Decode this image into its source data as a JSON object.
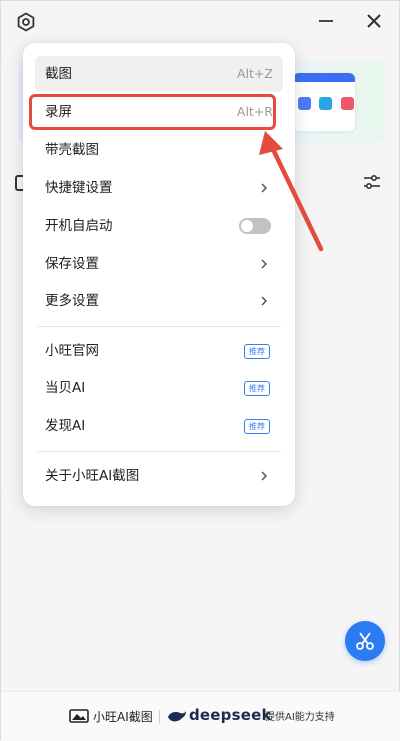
{
  "menu": {
    "items": [
      {
        "label": "截图",
        "shortcut": "Alt+Z"
      },
      {
        "label": "录屏",
        "shortcut": "Alt+R"
      },
      {
        "label": "带壳截图"
      },
      {
        "label": "快捷键设置"
      },
      {
        "label": "开机自启动",
        "toggle_on": false
      },
      {
        "label": "保存设置"
      },
      {
        "label": "更多设置"
      },
      {
        "label": "小旺官网",
        "badge": "推荐"
      },
      {
        "label": "当贝AI",
        "badge": "推荐"
      },
      {
        "label": "发现AI",
        "badge": "推荐"
      },
      {
        "label": "关于小旺AI截图"
      }
    ]
  },
  "footer": {
    "app_name": "小旺AI截图",
    "partner": "deepseek",
    "support_text": "提供AI能力支持"
  },
  "icons": {
    "settings": "gear-icon",
    "minimize": "minimize-icon",
    "close": "close-icon",
    "filter": "sliders-icon",
    "fab": "scissors-icon",
    "submenu": "chevron-right-icon"
  },
  "colors": {
    "accent": "#2b7bf3",
    "highlight": "#e34b3d",
    "badge": "#3b7cf0"
  }
}
